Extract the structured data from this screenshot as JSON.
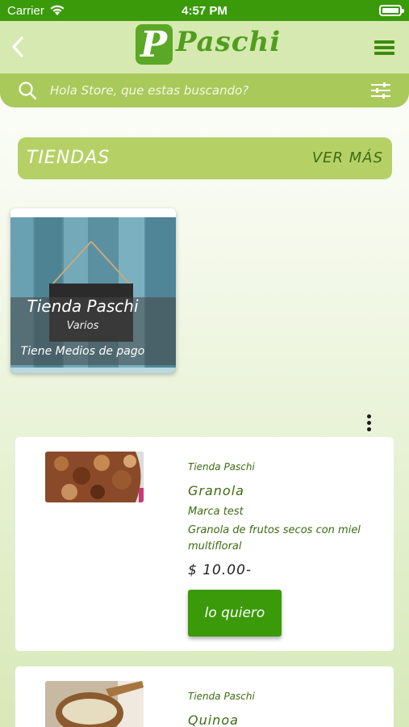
{
  "status_bar": {
    "carrier": "Carrier",
    "time": "4:57 PM"
  },
  "header": {
    "logo_text": "Paschi",
    "logo_letter": "P"
  },
  "search": {
    "placeholder": "Hola Store, que estas buscando?"
  },
  "stores_section": {
    "title": "TIENDAS",
    "see_more": "VER MÁS"
  },
  "store_card": {
    "name": "Tienda Paschi",
    "category": "Varios",
    "payment": "Tiene Medios de pago"
  },
  "products": [
    {
      "store": "Tienda Paschi",
      "name": "Granola",
      "brand": "Marca test",
      "description": "Granola de frutos secos con miel multifloral",
      "price": "$ 10.00-",
      "button": "lo quiero"
    },
    {
      "store": "Tienda Paschi",
      "name": "Quinoa"
    }
  ],
  "colors": {
    "primary": "#3b9a0a",
    "header_bg": "#d6e9b0",
    "search_bg": "#a9c95a",
    "section_bg": "#b5d166",
    "text_green": "#3e6b12"
  },
  "icons": [
    "wifi-icon",
    "battery-icon",
    "back-chevron-icon",
    "hamburger-menu-icon",
    "search-icon",
    "filter-sliders-icon",
    "more-vertical-icon"
  ]
}
